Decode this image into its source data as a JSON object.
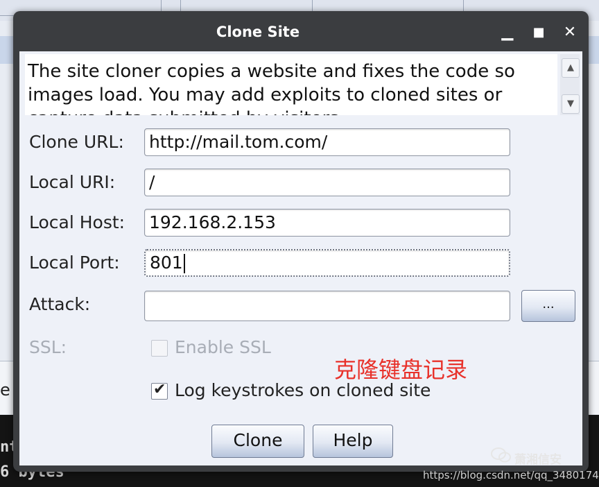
{
  "background": {
    "row_text": "e",
    "terminal_lines": [
      "nt",
      "6 bytes"
    ]
  },
  "dialog": {
    "title": "Clone Site",
    "minimize_glyph": "▁",
    "maximize_glyph": "■",
    "close_glyph": "✕",
    "description": "The site cloner copies a website and fixes the code so images load. You may add exploits to cloned sites or capture data submitted by visitors",
    "fields": {
      "clone_url": {
        "label": "Clone URL:",
        "value": "http://mail.tom.com/"
      },
      "local_uri": {
        "label": "Local URI:",
        "value": "/"
      },
      "local_host": {
        "label": "Local Host:",
        "value": "192.168.2.153"
      },
      "local_port": {
        "label": "Local Port:",
        "value": "801"
      },
      "attack": {
        "label": "Attack:",
        "value": "",
        "browse_label": "..."
      }
    },
    "ssl": {
      "label": "SSL:",
      "checkbox_label": "Enable SSL",
      "checked": false,
      "enabled": false
    },
    "log_keystrokes": {
      "label": "Log keystrokes on cloned site",
      "checked": true
    },
    "buttons": {
      "clone": "Clone",
      "help": "Help"
    },
    "annotation": "克隆键盘记录"
  },
  "watermark": {
    "name": "萧湘信安",
    "url": "https://blog.csdn.net/qq_34801745"
  }
}
